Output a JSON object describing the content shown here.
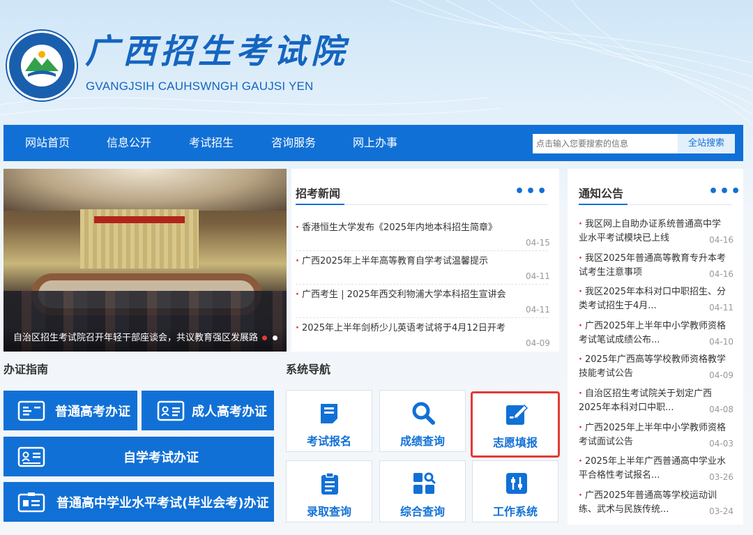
{
  "site": {
    "title_zh": "广西招生考试院",
    "title_roman": "GVANGJSIH CAUHSWNGH GAUJSI YEN",
    "logo_ring_text": "GVANGJSIH CAUHSWNGH GAUJSI YEN"
  },
  "nav": {
    "items": [
      "网站首页",
      "信息公开",
      "考试招生",
      "咨询服务",
      "网上办事"
    ],
    "search_placeholder": "点击输入您要搜索的信息",
    "search_button": "全站搜索"
  },
  "slider": {
    "caption": "自治区招生考试院召开年轻干部座谈会，共议教育强区发展路"
  },
  "news": {
    "title": "招考新闻",
    "more": "•••",
    "items": [
      {
        "text": "香港恒生大学发布《2025年内地本科招生简章》",
        "date": "04-15"
      },
      {
        "text": "广西2025年上半年高等教育自学考试温馨提示",
        "date": "04-11"
      },
      {
        "text": "广西考生 | 2025年西交利物浦大学本科招生宣讲会",
        "date": "04-11"
      },
      {
        "text": "2025年上半年剑桥少儿英语考试将于4月12日开考",
        "date": "04-09"
      }
    ]
  },
  "notices": {
    "title": "通知公告",
    "more": "•••",
    "items": [
      {
        "line1": "我区网上自助办证系统普通高中学",
        "line2": "业水平考试模块已上线",
        "date": "04-16"
      },
      {
        "line1": "我区2025年普通高等教育专升本考",
        "line2": "试考生注意事项",
        "date": "04-16"
      },
      {
        "line1": "我区2025年本科对口中职招生、分",
        "line2": "类考试招生于4月...",
        "date": "04-11"
      },
      {
        "line1": "广西2025年上半年中小学教师资格",
        "line2": "考试笔试成绩公布...",
        "date": "04-10"
      },
      {
        "line1": "2025年广西高等学校教师资格教学",
        "line2": "技能考试公告",
        "date": "04-09"
      },
      {
        "line1": "自治区招生考试院关于划定广西",
        "line2": "2025年本科对口中职...",
        "date": "04-08"
      },
      {
        "line1": "广西2025年上半年中小学教师资格",
        "line2": "考试面试公告",
        "date": "04-03"
      },
      {
        "line1": "2025年上半年广西普通高中学业水",
        "line2": "平合格性考试报名...",
        "date": "03-26"
      },
      {
        "line1": "广西2025年普通高等学校运动训",
        "line2": "练、武术与民族传统...",
        "date": "03-24"
      }
    ]
  },
  "guide": {
    "title": "办证指南",
    "buttons": [
      "普通高考办证",
      "成人高考办证",
      "自学考试办证",
      "普通高中学业水平考试(毕业会考)办证"
    ]
  },
  "system_nav": {
    "title": "系统导航",
    "tiles": [
      "考试报名",
      "成绩查询",
      "志愿填报",
      "录取查询",
      "综合查询",
      "工作系统"
    ]
  },
  "colors": {
    "primary": "#1170d6",
    "highlight_border": "#e53935",
    "bullet": "#e02a2a"
  }
}
